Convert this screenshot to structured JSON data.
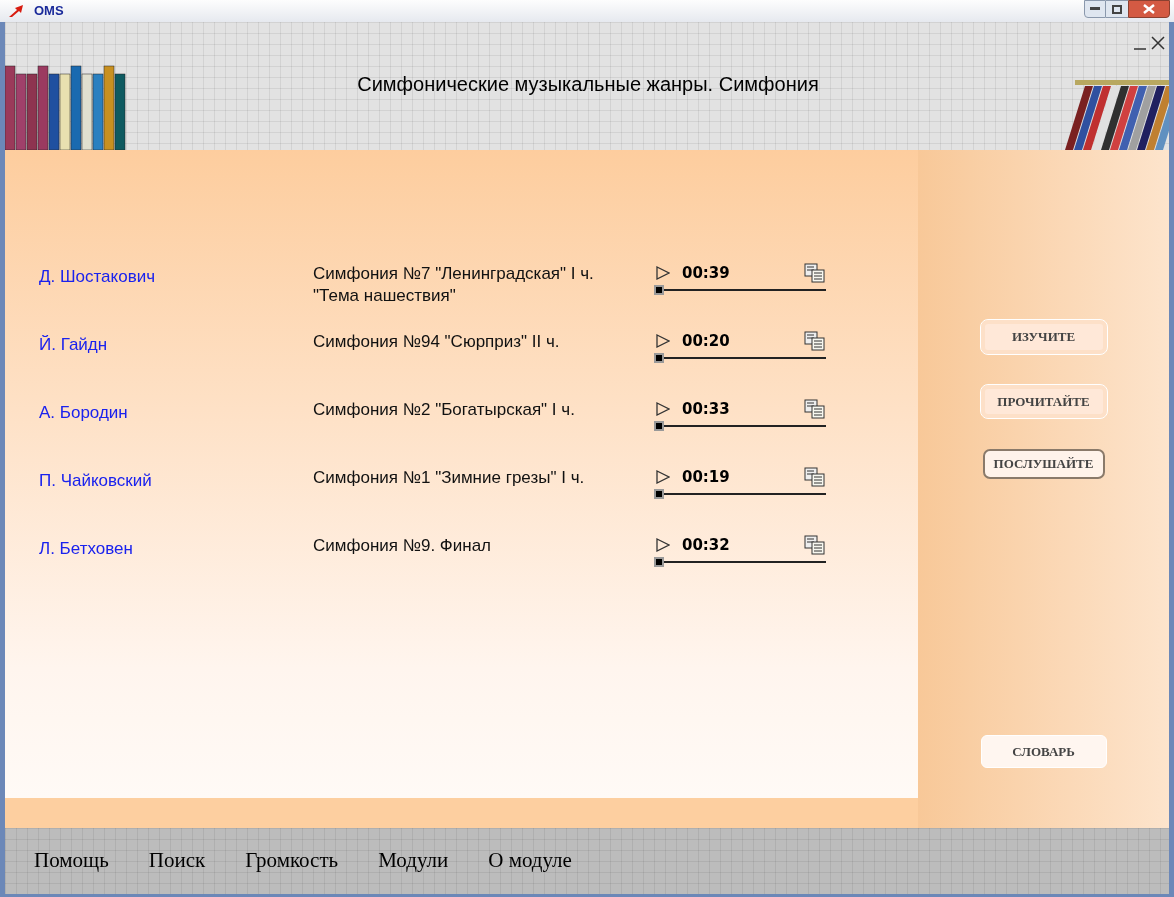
{
  "window": {
    "title": "OMS"
  },
  "header": {
    "title": "Симфонические музыкальные жанры. Симфония"
  },
  "tracks": [
    {
      "composer": "Д. Шостакович",
      "work": "Симфония №7 \"Ленинградская\" I ч. \"Тема нашествия\"",
      "time": "00:39",
      "level": 0
    },
    {
      "composer": "Й. Гайдн",
      "work": "Симфония №94 \"Сюрприз\" II ч.",
      "time": "00:20",
      "level": 0
    },
    {
      "composer": "А. Бородин",
      "work": "Симфония №2 \"Богатырская\" I ч.",
      "time": "00:33",
      "level": 0
    },
    {
      "composer": "П. Чайковский",
      "work": "Симфония №1 \"Зимние грезы\" I ч.",
      "time": "00:19",
      "level": 0
    },
    {
      "composer": "Л. Бетховен",
      "work": "Симфония №9. Финал",
      "time": "00:32",
      "level": 0
    }
  ],
  "side_buttons": [
    {
      "label": "ИЗУЧИТЕ",
      "selected": false
    },
    {
      "label": "ПРОЧИТАЙТЕ",
      "selected": false
    },
    {
      "label": "ПОСЛУШАЙТЕ",
      "selected": true
    }
  ],
  "dictionary_button": "СЛОВАРЬ",
  "bottom_menu": [
    "Помощь",
    "Поиск",
    "Громкость",
    "Модули",
    "О модуле"
  ]
}
